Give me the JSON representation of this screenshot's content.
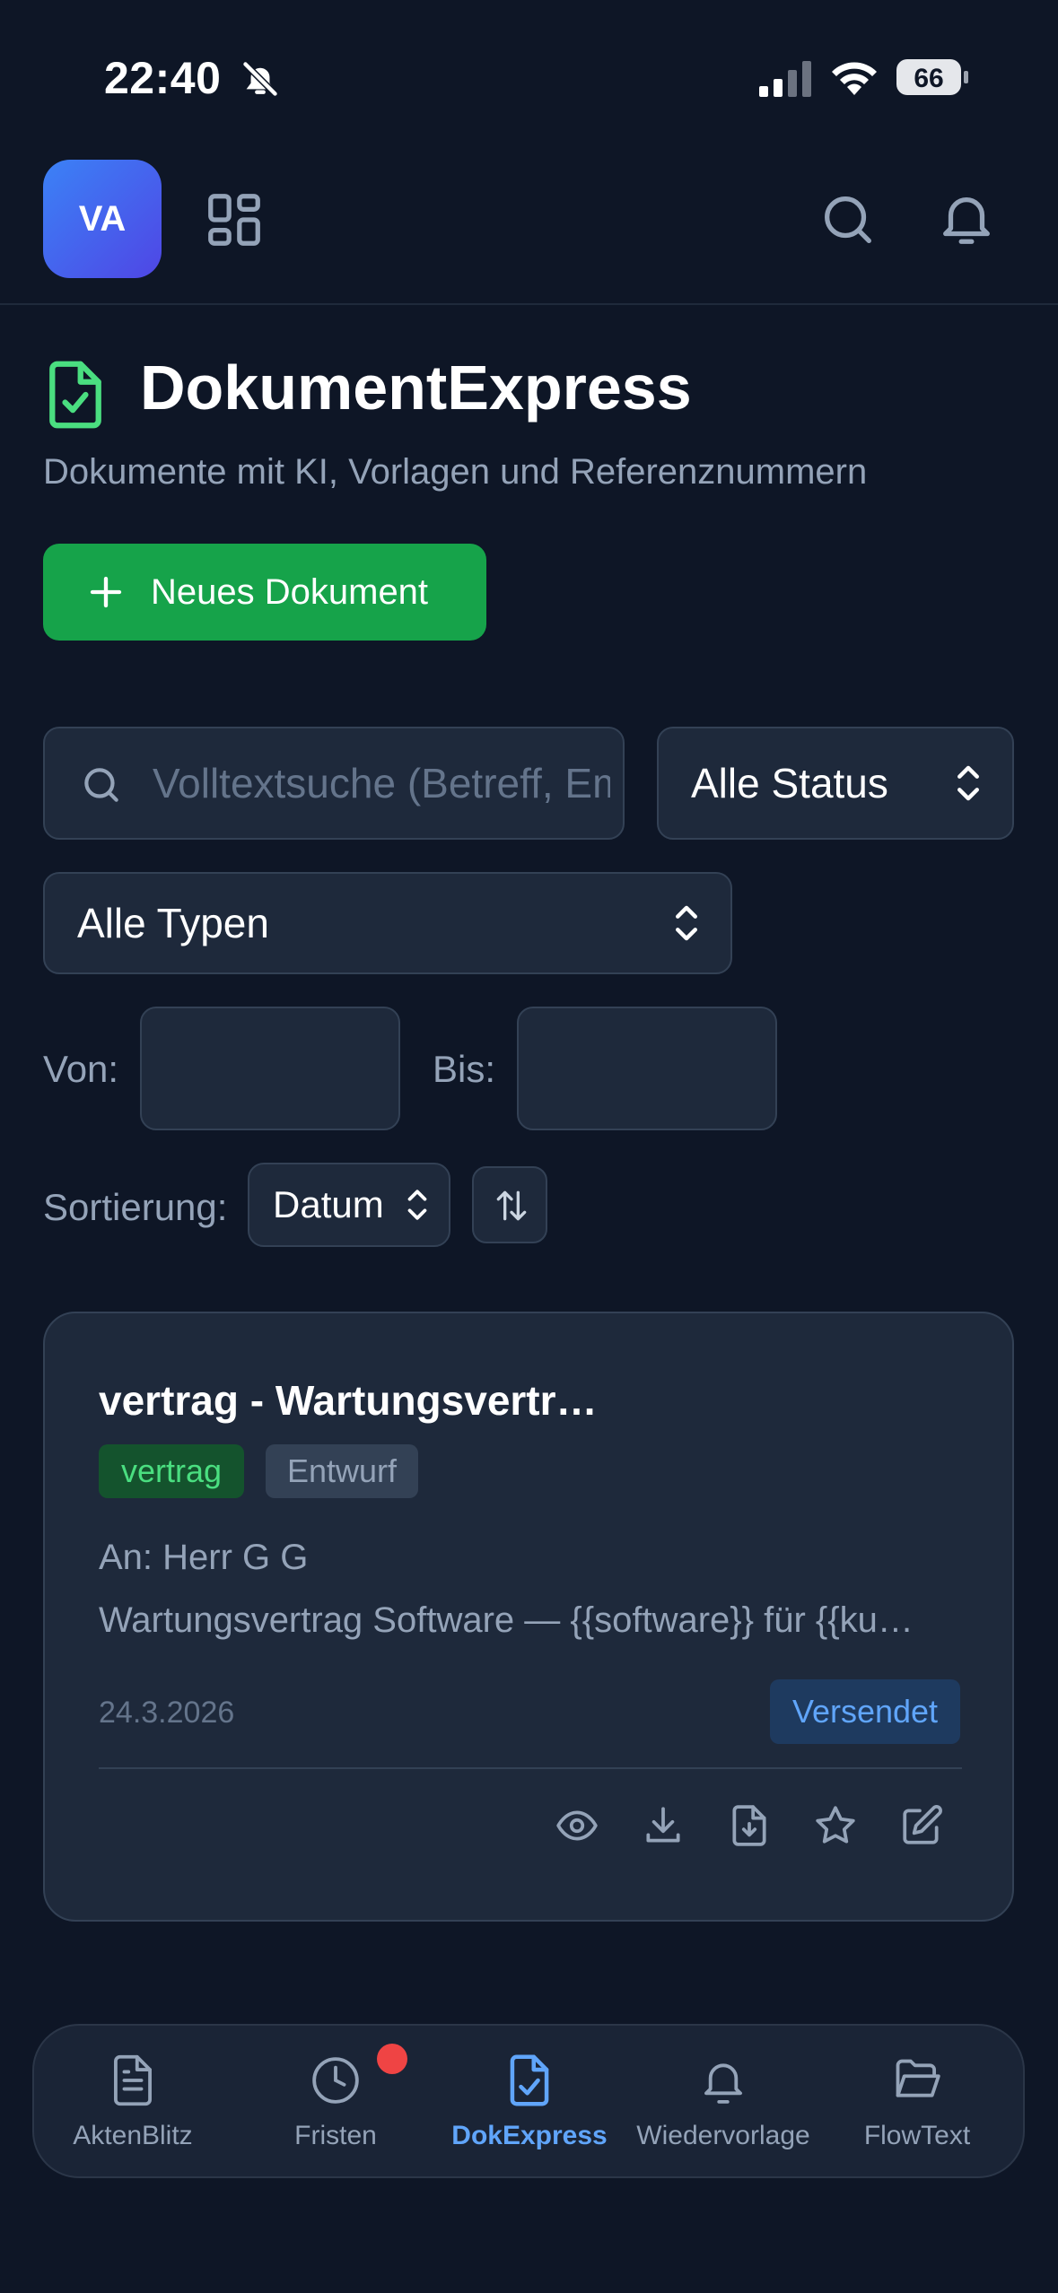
{
  "status_bar": {
    "time": "22:40",
    "battery": "66"
  },
  "header": {
    "avatar_initials": "VA"
  },
  "page": {
    "title": "DokumentExpress",
    "subtitle": "Dokumente mit KI, Vorlagen und Referenznummern",
    "new_button_label": "Neues Dokument"
  },
  "filters": {
    "search_placeholder": "Volltextsuche (Betreff, Empfänger, Inhalt)",
    "status_value": "Alle Status",
    "type_value": "Alle Typen",
    "from_label": "Von:",
    "to_label": "Bis:",
    "sort_label": "Sortierung:",
    "sort_value": "Datum"
  },
  "documents": [
    {
      "title": "vertrag - Wartungsvertr…",
      "type_badge": "vertrag",
      "state_badge": "Entwurf",
      "recipient": "An: Herr G G",
      "subject": "Wartungsvertrag Software — {{software}} für {{ku…",
      "date": "24.3.2026",
      "status": "Versendet"
    }
  ],
  "bottom_nav": {
    "items": [
      {
        "label": "AktenBlitz",
        "icon": "document-icon"
      },
      {
        "label": "Fristen",
        "icon": "clock-icon"
      },
      {
        "label": "DokExpress",
        "icon": "file-check-icon"
      },
      {
        "label": "Wiedervorlage",
        "icon": "bell-icon"
      },
      {
        "label": "FlowText",
        "icon": "folder-open-icon"
      }
    ],
    "active": "DokExpress"
  },
  "colors": {
    "background": "#0e1626",
    "surface": "#1e293b",
    "accent_green": "#16a34a",
    "accent_blue": "#60a5fa",
    "notification_red": "#ef4444"
  }
}
